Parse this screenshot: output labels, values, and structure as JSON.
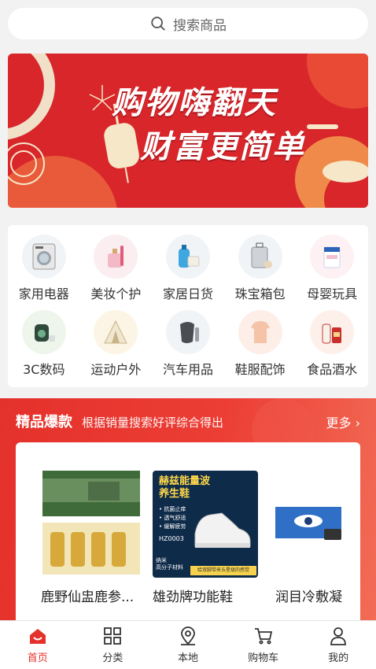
{
  "search": {
    "placeholder": "搜索商品"
  },
  "banner": {
    "line1": "购物嗨翻天",
    "line2": "财富更简单"
  },
  "categories": [
    {
      "label": "家用电器",
      "icon": "washing-machine-icon"
    },
    {
      "label": "美妆个护",
      "icon": "perfume-icon"
    },
    {
      "label": "家居日货",
      "icon": "toiletries-icon"
    },
    {
      "label": "珠宝箱包",
      "icon": "luggage-icon"
    },
    {
      "label": "母婴玩具",
      "icon": "milk-powder-icon"
    },
    {
      "label": "3C数码",
      "icon": "speaker-icon"
    },
    {
      "label": "运动户外",
      "icon": "tent-icon"
    },
    {
      "label": "汽车用品",
      "icon": "car-seat-icon"
    },
    {
      "label": "鞋服配饰",
      "icon": "clothes-icon"
    },
    {
      "label": "食品酒水",
      "icon": "liquor-icon"
    }
  ],
  "hot": {
    "title": "精品爆款",
    "subtitle": "根据销量搜索好评综合得出",
    "more": "更多",
    "products": [
      {
        "name": "鹿野仙盅鹿参..."
      },
      {
        "name": "雄劲牌功能鞋",
        "img_title_1": "赫兹能量波",
        "img_title_2": "养生鞋",
        "img_bullets": [
          "• 抗菌止痒",
          "• 透气舒适",
          "• 缓解疲劳"
        ],
        "img_code": "HZ0003",
        "img_footer_1": "纳米",
        "img_footer_2": "高分子材料",
        "img_slogan": "给双脚带来五星级的感觉"
      },
      {
        "name": "润目冷敷凝"
      }
    ]
  },
  "tabbar": [
    {
      "label": "首页",
      "active": true
    },
    {
      "label": "分类"
    },
    {
      "label": "本地"
    },
    {
      "label": "购物车"
    },
    {
      "label": "我的"
    }
  ],
  "colors": {
    "primary": "#e4312b",
    "bg": "#f2f2f2"
  }
}
